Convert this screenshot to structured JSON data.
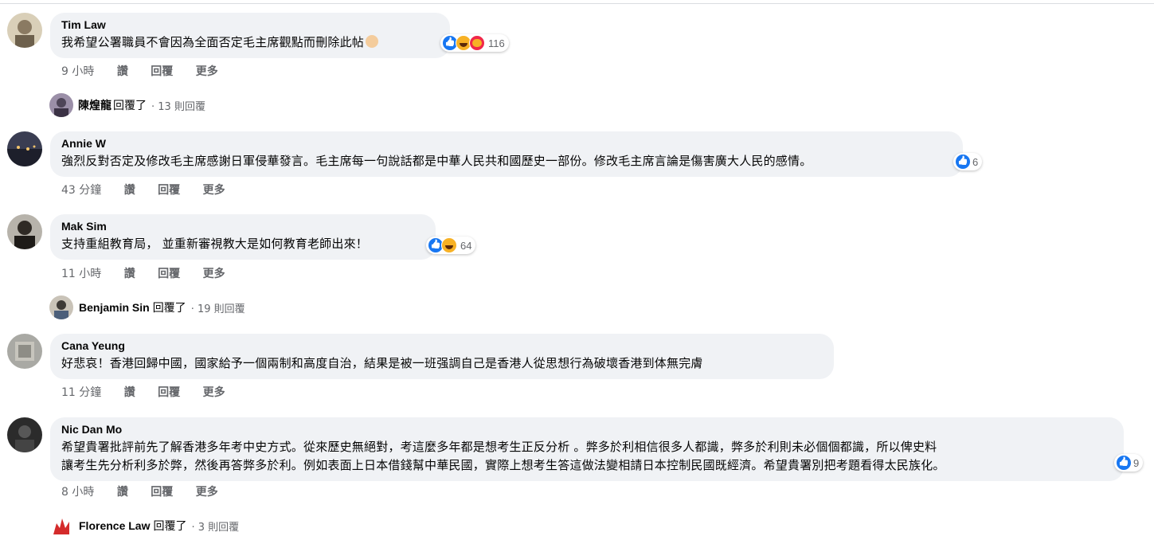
{
  "comments": [
    {
      "author": "Tim Law",
      "text": "我希望公署職員不會因為全面否定毛主席觀點而刪除此帖",
      "reaction_types": [
        "like",
        "haha",
        "love"
      ],
      "reaction_count": "116",
      "time": "9 小時",
      "actions": [
        "讚",
        "回覆",
        "更多"
      ],
      "reply": {
        "name": "陳煌龍",
        "verb": "回覆了",
        "count": "· 13 則回覆"
      }
    },
    {
      "author": "Annie W",
      "text": "強烈反對否定及修改毛主席感謝日軍侵華發言。毛主席每一句說話都是中華人民共和國歷史一部份。修改毛主席言論是傷害廣大人民的感情。",
      "reaction_types": [
        "like"
      ],
      "reaction_count": "6",
      "time": "43 分鐘",
      "actions": [
        "讚",
        "回覆",
        "更多"
      ]
    },
    {
      "author": "Mak Sim",
      "text": "支持重組教育局， 並重新審視教大是如何教育老師出來！",
      "reaction_types": [
        "like",
        "haha"
      ],
      "reaction_count": "64",
      "time": "11 小時",
      "actions": [
        "讚",
        "回覆",
        "更多"
      ],
      "reply": {
        "name": "Benjamin Sin",
        "verb": "回覆了",
        "count": "· 19 則回覆"
      }
    },
    {
      "author": "Cana Yeung",
      "text": "好悲哀！香港回歸中國，國家給予一個兩制和高度自治，結果是被一班强調自己是香港人從思想行為破壞香港到体無完膚",
      "time": "11 分鐘",
      "actions": [
        "讚",
        "回覆",
        "更多"
      ]
    },
    {
      "author": "Nic Dan Mo",
      "text_line1": "希望貴署批評前先了解香港多年考中史方式。從來歷史無絕對，考這麼多年都是想考生正反分析 。弊多於利相信很多人都識，弊多於利則未必個個都識，所以俾史料",
      "text_line2": "讓考生先分析利多於弊，然後再答弊多於利。例如表面上日本借錢幫中華民國，實際上想考生答這做法變相請日本控制民國既經濟。希望貴署別把考題看得太民族化。",
      "reaction_types": [
        "like"
      ],
      "reaction_count": "9",
      "time": "8 小時",
      "actions": [
        "讚",
        "回覆",
        "更多"
      ],
      "reply": {
        "name": "Florence Law",
        "verb": "回覆了",
        "count": "· 3 則回覆"
      }
    }
  ],
  "colors": {
    "bubble": "#f0f2f5",
    "meta": "#65676b",
    "like": "#1877f2"
  }
}
